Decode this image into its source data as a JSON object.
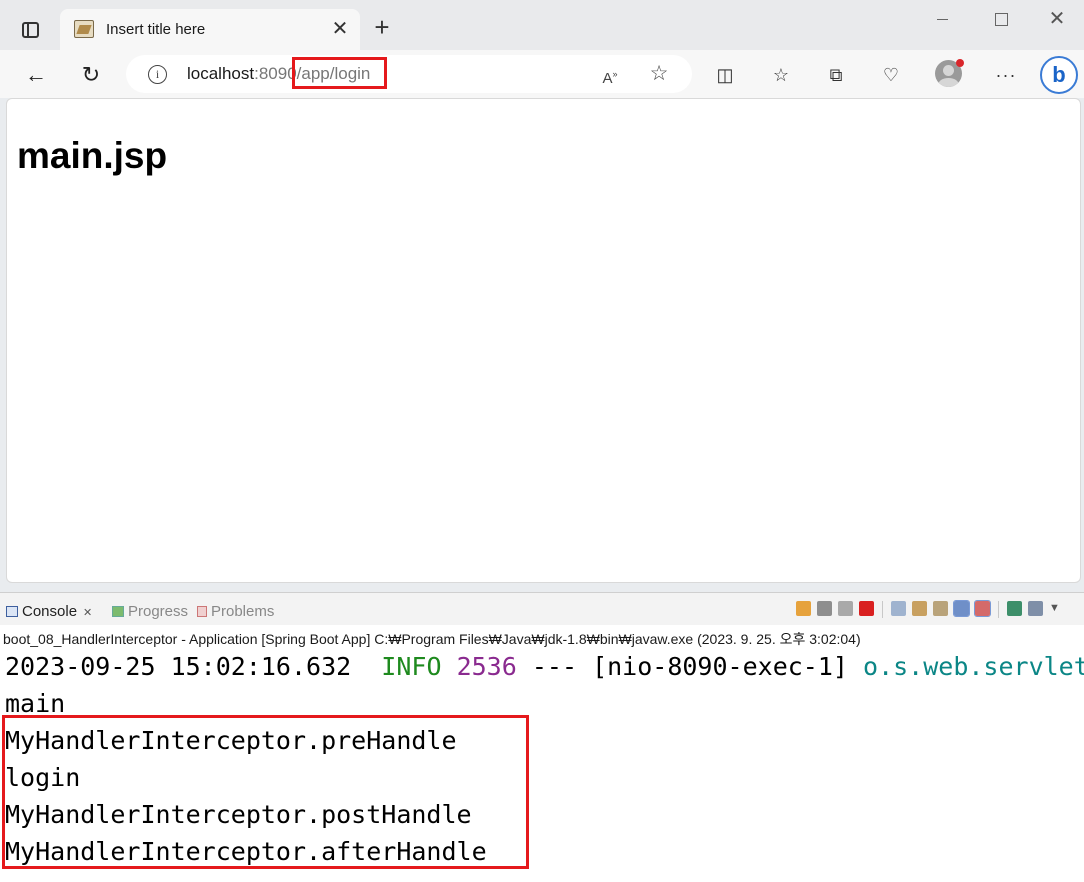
{
  "browser": {
    "tab": {
      "title": "Insert title here"
    },
    "address": {
      "host": "localhost",
      "port": ":8090",
      "path": "/app/login"
    },
    "page": {
      "heading": "main.jsp"
    }
  },
  "console": {
    "tabs": [
      {
        "label": "Console"
      },
      {
        "label": "Progress"
      },
      {
        "label": "Problems"
      }
    ],
    "launch_info": "boot_08_HandlerInterceptor - Application [Spring Boot App] C:₩Program Files₩Java₩jdk-1.8₩bin₩javaw.exe  (2023. 9. 25. 오후 3:02:04)",
    "log_line": {
      "timestamp": "2023-09-25 15:02:16.632",
      "level": "INFO",
      "pid": "2536",
      "separator": "---",
      "thread": "[nio-8090-exec-1]",
      "logger": "o.s.web.servlet.DispatcherServlet"
    },
    "output_lines": [
      "main",
      "MyHandlerInterceptor.preHandle",
      "login",
      "MyHandlerInterceptor.postHandle",
      "MyHandlerInterceptor.afterHandle"
    ]
  },
  "colors": {
    "highlight": "#e5191c",
    "log_info": "#1e8a1e",
    "log_pid": "#8a2a8f",
    "log_logger": "#0b8686"
  },
  "icons": {
    "tab_actions": "tab-actions-icon",
    "favicon": "tomcat-favicon",
    "close": "close-icon",
    "new_tab": "plus-icon",
    "back": "arrow-left-icon",
    "reload": "reload-icon",
    "info": "info-icon",
    "read_aloud": "read-aloud-icon",
    "favorite": "star-icon",
    "split_screen": "split-screen-icon",
    "favorites": "favorites-icon",
    "collections": "collections-icon",
    "browser_essentials": "heart-pulse-icon",
    "profile": "avatar",
    "more": "more-icon",
    "copilot": "bing-icon"
  }
}
